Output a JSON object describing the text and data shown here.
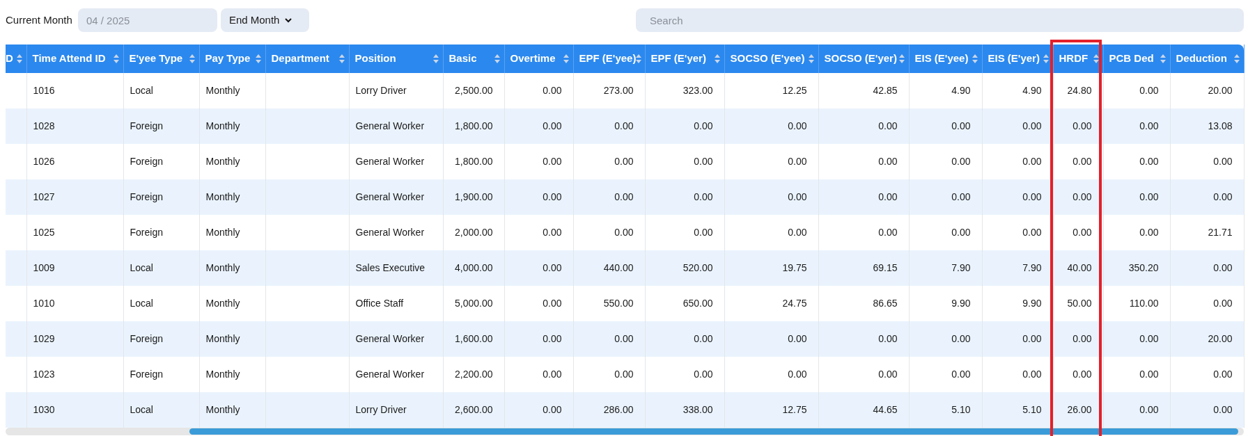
{
  "filters": {
    "current_month_label": "Current Month",
    "current_month_placeholder": "04 / 2025",
    "end_month": "End Month",
    "search_placeholder": "Search"
  },
  "columns": [
    {
      "label": "D",
      "kind": "text",
      "highlighted": false
    },
    {
      "label": "Time Attend ID",
      "kind": "text",
      "highlighted": false
    },
    {
      "label": "E'yee Type",
      "kind": "text",
      "highlighted": false
    },
    {
      "label": "Pay Type",
      "kind": "text",
      "highlighted": false
    },
    {
      "label": "Department",
      "kind": "text",
      "highlighted": false
    },
    {
      "label": "Position",
      "kind": "text",
      "highlighted": false
    },
    {
      "label": "Basic",
      "kind": "number",
      "highlighted": false
    },
    {
      "label": "Overtime",
      "kind": "number",
      "highlighted": false
    },
    {
      "label": "EPF (E'yee)",
      "kind": "number",
      "highlighted": false
    },
    {
      "label": "EPF (E'yer)",
      "kind": "number",
      "highlighted": false
    },
    {
      "label": "SOCSO (E'yee)",
      "kind": "number",
      "highlighted": false
    },
    {
      "label": "SOCSO (E'yer)",
      "kind": "number",
      "highlighted": false
    },
    {
      "label": "EIS (E'yee)",
      "kind": "number",
      "highlighted": false
    },
    {
      "label": "EIS (E'yer)",
      "kind": "number",
      "highlighted": false
    },
    {
      "label": "HRDF",
      "kind": "number",
      "highlighted": true
    },
    {
      "label": "PCB Ded",
      "kind": "number",
      "highlighted": false
    },
    {
      "label": "Deduction",
      "kind": "number",
      "highlighted": false
    }
  ],
  "rows": [
    {
      "cells": [
        null,
        "1016",
        "Local",
        "Monthly",
        null,
        "Lorry Driver",
        "2,500.00",
        "0.00",
        "273.00",
        "323.00",
        "12.25",
        "42.85",
        "4.90",
        "4.90",
        "24.80",
        "0.00",
        "20.00"
      ]
    },
    {
      "cells": [
        null,
        "1028",
        "Foreign",
        "Monthly",
        null,
        "General Worker",
        "1,800.00",
        "0.00",
        "0.00",
        "0.00",
        "0.00",
        "0.00",
        "0.00",
        "0.00",
        "0.00",
        "0.00",
        "13.08"
      ]
    },
    {
      "cells": [
        null,
        "1026",
        "Foreign",
        "Monthly",
        null,
        "General Worker",
        "1,800.00",
        "0.00",
        "0.00",
        "0.00",
        "0.00",
        "0.00",
        "0.00",
        "0.00",
        "0.00",
        "0.00",
        "0.00"
      ]
    },
    {
      "cells": [
        null,
        "1027",
        "Foreign",
        "Monthly",
        null,
        "General Worker",
        "1,900.00",
        "0.00",
        "0.00",
        "0.00",
        "0.00",
        "0.00",
        "0.00",
        "0.00",
        "0.00",
        "0.00",
        "0.00"
      ]
    },
    {
      "cells": [
        null,
        "1025",
        "Foreign",
        "Monthly",
        null,
        "General Worker",
        "2,000.00",
        "0.00",
        "0.00",
        "0.00",
        "0.00",
        "0.00",
        "0.00",
        "0.00",
        "0.00",
        "0.00",
        "21.71"
      ]
    },
    {
      "cells": [
        null,
        "1009",
        "Local",
        "Monthly",
        null,
        "Sales Executive",
        "4,000.00",
        "0.00",
        "440.00",
        "520.00",
        "19.75",
        "69.15",
        "7.90",
        "7.90",
        "40.00",
        "350.20",
        "0.00"
      ]
    },
    {
      "cells": [
        null,
        "1010",
        "Local",
        "Monthly",
        null,
        "Office Staff",
        "5,000.00",
        "0.00",
        "550.00",
        "650.00",
        "24.75",
        "86.65",
        "9.90",
        "9.90",
        "50.00",
        "110.00",
        "0.00"
      ]
    },
    {
      "cells": [
        null,
        "1029",
        "Foreign",
        "Monthly",
        null,
        "General Worker",
        "1,600.00",
        "0.00",
        "0.00",
        "0.00",
        "0.00",
        "0.00",
        "0.00",
        "0.00",
        "0.00",
        "0.00",
        "20.00"
      ]
    },
    {
      "cells": [
        null,
        "1023",
        "Foreign",
        "Monthly",
        null,
        "General Worker",
        "2,200.00",
        "0.00",
        "0.00",
        "0.00",
        "0.00",
        "0.00",
        "0.00",
        "0.00",
        "0.00",
        "0.00",
        "0.00"
      ]
    },
    {
      "cells": [
        null,
        "1030",
        "Local",
        "Monthly",
        null,
        "Lorry Driver",
        "2,600.00",
        "0.00",
        "286.00",
        "338.00",
        "12.75",
        "44.65",
        "5.10",
        "5.10",
        "26.00",
        "0.00",
        "0.00"
      ]
    }
  ]
}
